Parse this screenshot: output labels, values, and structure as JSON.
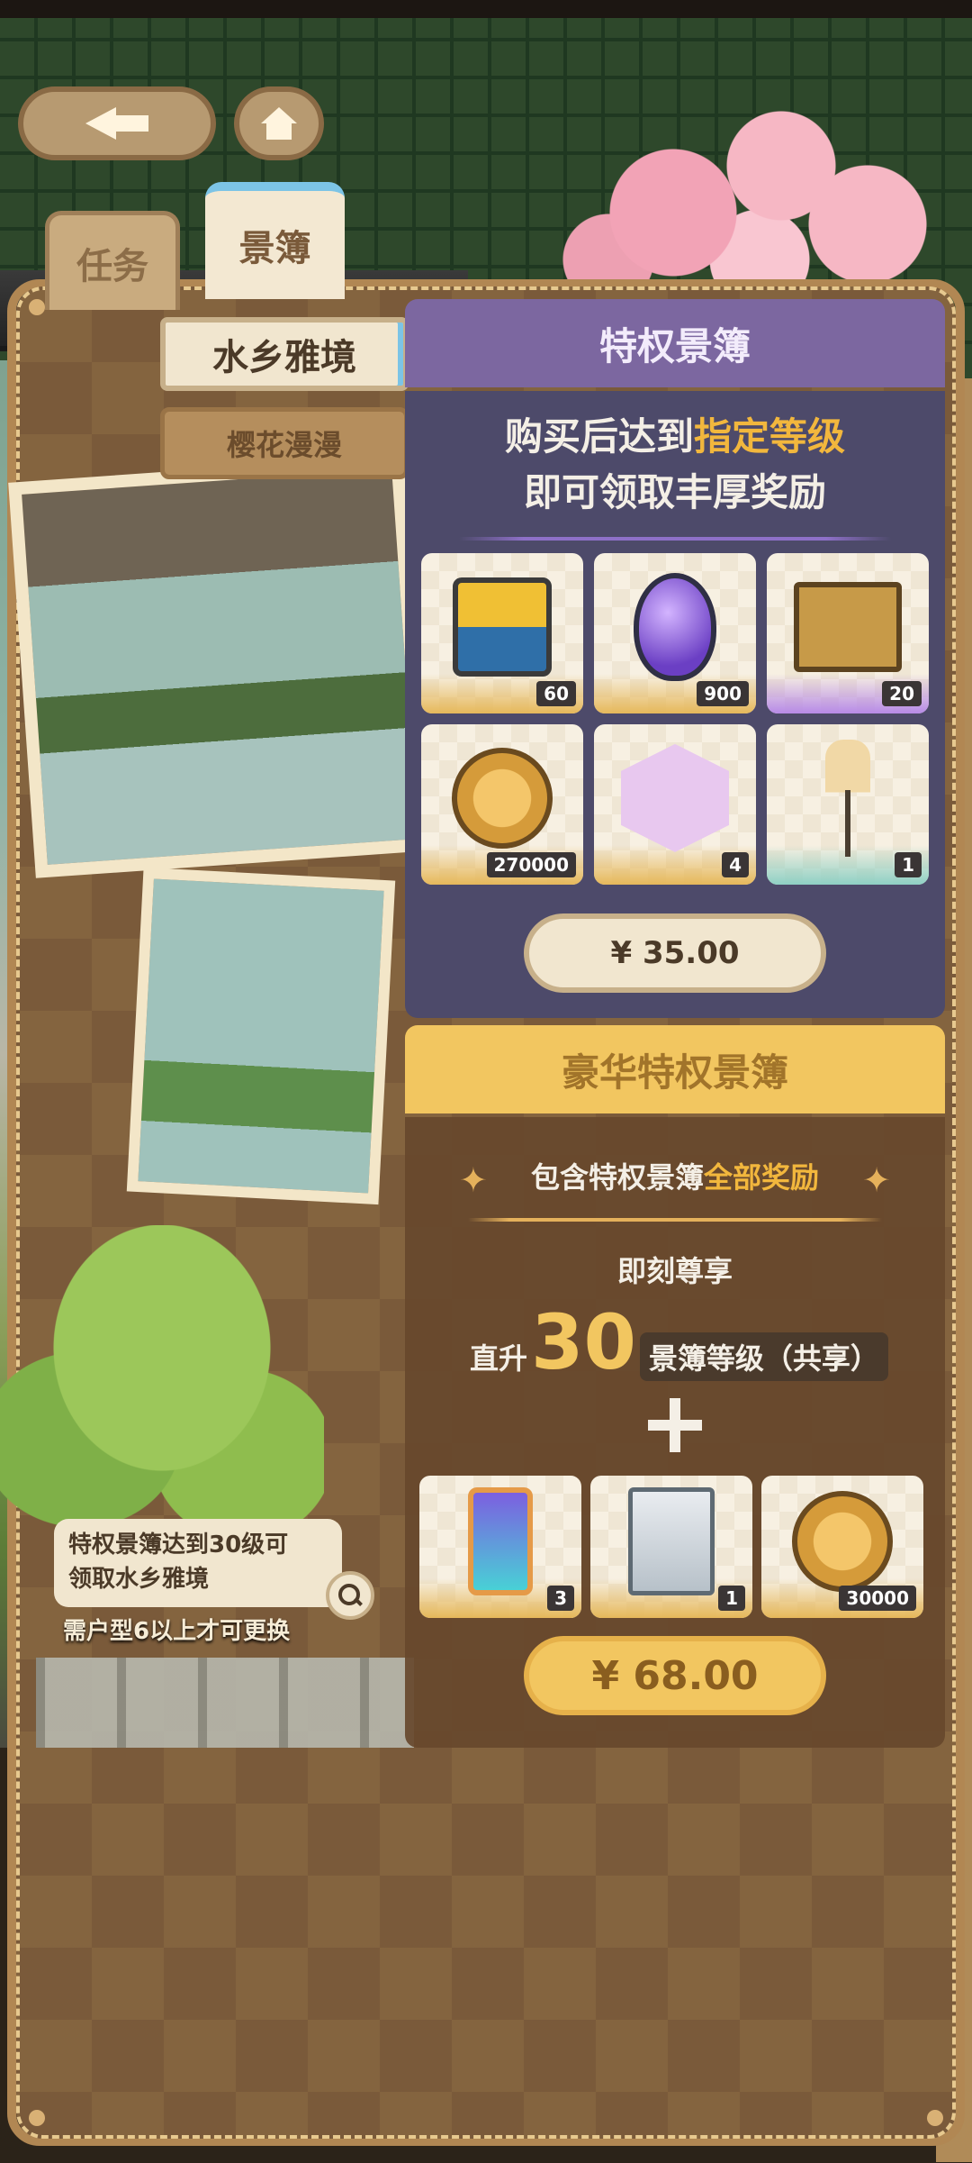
{
  "nav": {
    "back_icon": "arrow-left-icon",
    "home_icon": "house-icon"
  },
  "tabs": [
    {
      "label": "任务",
      "selected": false
    },
    {
      "label": "景簿",
      "selected": true
    }
  ],
  "scenery": {
    "title": "水乡雅境",
    "subtitle": "樱花漫漫",
    "hint_line1": "特权景簿达到30级可",
    "hint_line2": "领取水乡雅境",
    "note": "需户型6以上才可更换"
  },
  "privilege": {
    "header": "特权景簿",
    "desc_part1": "购买后达到",
    "desc_highlight": "指定等级",
    "desc_line2": "即可领取丰厚奖励",
    "rewards": [
      {
        "icon": "ticket-card-icon",
        "qty": "60",
        "tier": "gold"
      },
      {
        "icon": "purple-egg-icon",
        "qty": "900",
        "tier": "gold"
      },
      {
        "icon": "golden-book-icon",
        "qty": "20",
        "tier": "purple"
      },
      {
        "icon": "gold-coin-icon",
        "qty": "270000",
        "tier": "gold"
      },
      {
        "icon": "hexagon-crystal-icon",
        "qty": "4",
        "tier": "gold"
      },
      {
        "icon": "lamp-post-icon",
        "qty": "1",
        "tier": "teal"
      }
    ],
    "price": "¥ 35.00"
  },
  "deluxe": {
    "header": "豪华特权景簿",
    "sub_part1": "包含特权景簿",
    "sub_highlight": "全部奖励",
    "now_label": "即刻尊享",
    "level_pre": "直升",
    "level_num": "30",
    "level_post": "景簿等级（共享）",
    "rewards": [
      {
        "icon": "phone-card-icon",
        "qty": "3",
        "tier": "gold"
      },
      {
        "icon": "cart-stall-icon",
        "qty": "1",
        "tier": "gold"
      },
      {
        "icon": "gold-coin-icon",
        "qty": "30000",
        "tier": "gold"
      }
    ],
    "price": "¥ 68.00"
  },
  "colors": {
    "privilege_header": "#7c67a0",
    "privilege_body": "#4d4a6a",
    "deluxe_header": "#f2c660",
    "highlight": "#f2b73d"
  }
}
